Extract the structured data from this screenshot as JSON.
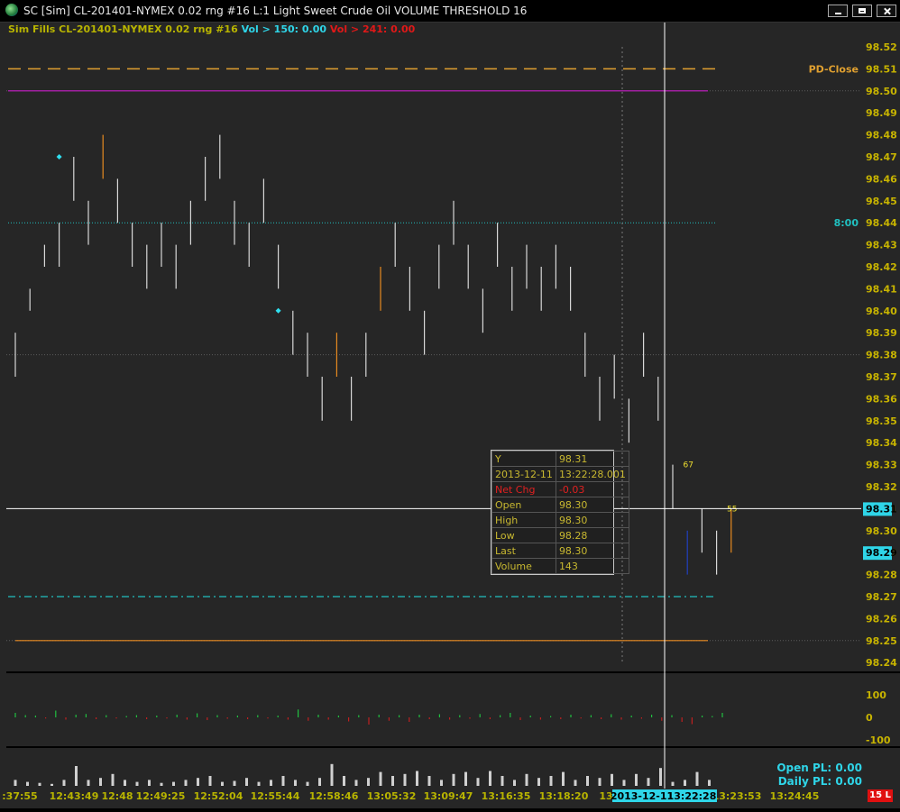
{
  "window": {
    "title": "SC [Sim]  CL-201401-NYMEX  0.02 rng  #16  L:1  Light Sweet Crude Oil  VOLUME THRESHOLD 16",
    "icons": [
      "globe-icon",
      "minimize-icon",
      "maximize-icon",
      "close-icon"
    ]
  },
  "legend": {
    "study": "Sim Fills  CL-201401-NYMEX  0.02 rng  #16",
    "vol_a": "Vol > 150: 0.00",
    "vol_b": "Vol > 241: 0.00"
  },
  "levels": {
    "pd_close_label": "PD-Close",
    "time_label": "8:00"
  },
  "colors": {
    "background": "#262626",
    "bar_white": "#d8d8d8",
    "bar_orange": "#e88a20",
    "bar_blue": "#2040c0",
    "pd_close": "#e0a030",
    "purple_line": "#a020a0",
    "cyan_line": "#20c0c0",
    "axis_text": "#c8b400",
    "cyan_badge": "#2fd5e8",
    "red_badge": "#e01010"
  },
  "data_window": {
    "rows": [
      {
        "label": "Y",
        "value": "98.31"
      },
      {
        "label": "2013-12-11",
        "value": "13:22:28.001"
      },
      {
        "label": "Net Chg",
        "value": "-0.03",
        "red": true
      },
      {
        "label": "Open",
        "value": "98.30"
      },
      {
        "label": "High",
        "value": "98.30"
      },
      {
        "label": "Low",
        "value": "98.28"
      },
      {
        "label": "Last",
        "value": "98.30"
      },
      {
        "label": "Volume",
        "value": "143"
      }
    ]
  },
  "footer": {
    "open_pl": "Open PL: 0.00",
    "daily_pl": "Daily PL: 0.00",
    "badge": "15 L",
    "cursor_date": "2013-12-11",
    "cursor_time": "13:22:28"
  },
  "chart_data": {
    "type": "bar",
    "subtype": "ohlc-range-bars",
    "y_ticks": [
      "98.52",
      "98.51",
      "98.50",
      "98.49",
      "98.48",
      "98.47",
      "98.46",
      "98.45",
      "98.44",
      "98.43",
      "98.42",
      "98.41",
      "98.40",
      "98.39",
      "98.38",
      "98.37",
      "98.36",
      "98.35",
      "98.34",
      "98.33",
      "98.32",
      "98.31",
      "98.30",
      "98.29",
      "98.28",
      "98.27",
      "98.26",
      "98.25",
      "98.24"
    ],
    "ylim": [
      98.24,
      98.52
    ],
    "x_ticks": [
      ":37:55",
      "12:43:49",
      "12:48",
      "12:49:25",
      "12:52:04",
      "12:55:44",
      "12:58:46",
      "13:05:32",
      "13:09:47",
      "13:16:35",
      "13:18:20",
      "13",
      "13:23:53",
      "13:24:45"
    ],
    "cursor_value": "98.31",
    "last_value": "98.29",
    "level_lines": {
      "pd_close": 98.51,
      "purple": 98.5,
      "cyan_dotted": 98.44,
      "cyan_dashdot": 98.27,
      "orange": 98.25
    },
    "bars": [
      {
        "high": 98.39,
        "low": 98.37,
        "color": "white"
      },
      {
        "high": 98.41,
        "low": 98.4,
        "color": "white"
      },
      {
        "high": 98.43,
        "low": 98.42,
        "color": "white"
      },
      {
        "high": 98.44,
        "low": 98.42,
        "color": "white"
      },
      {
        "high": 98.47,
        "low": 98.45,
        "color": "white"
      },
      {
        "high": 98.45,
        "low": 98.43,
        "color": "white"
      },
      {
        "high": 98.48,
        "low": 98.46,
        "color": "orange"
      },
      {
        "high": 98.46,
        "low": 98.44,
        "color": "white"
      },
      {
        "high": 98.44,
        "low": 98.42,
        "color": "white"
      },
      {
        "high": 98.43,
        "low": 98.41,
        "color": "white"
      },
      {
        "high": 98.44,
        "low": 98.42,
        "color": "white"
      },
      {
        "high": 98.43,
        "low": 98.41,
        "color": "white"
      },
      {
        "high": 98.45,
        "low": 98.43,
        "color": "white"
      },
      {
        "high": 98.47,
        "low": 98.45,
        "color": "white"
      },
      {
        "high": 98.48,
        "low": 98.46,
        "color": "white"
      },
      {
        "high": 98.45,
        "low": 98.43,
        "color": "white"
      },
      {
        "high": 98.44,
        "low": 98.42,
        "color": "white"
      },
      {
        "high": 98.46,
        "low": 98.44,
        "color": "white"
      },
      {
        "high": 98.43,
        "low": 98.41,
        "color": "white"
      },
      {
        "high": 98.4,
        "low": 98.38,
        "color": "white"
      },
      {
        "high": 98.39,
        "low": 98.37,
        "color": "white"
      },
      {
        "high": 98.37,
        "low": 98.35,
        "color": "white"
      },
      {
        "high": 98.39,
        "low": 98.37,
        "color": "orange"
      },
      {
        "high": 98.37,
        "low": 98.35,
        "color": "white"
      },
      {
        "high": 98.39,
        "low": 98.37,
        "color": "white"
      },
      {
        "high": 98.42,
        "low": 98.4,
        "color": "orange"
      },
      {
        "high": 98.44,
        "low": 98.42,
        "color": "white"
      },
      {
        "high": 98.42,
        "low": 98.4,
        "color": "white"
      },
      {
        "high": 98.4,
        "low": 98.38,
        "color": "white"
      },
      {
        "high": 98.43,
        "low": 98.41,
        "color": "white"
      },
      {
        "high": 98.45,
        "low": 98.43,
        "color": "white"
      },
      {
        "high": 98.43,
        "low": 98.41,
        "color": "white"
      },
      {
        "high": 98.41,
        "low": 98.39,
        "color": "white"
      },
      {
        "high": 98.44,
        "low": 98.42,
        "color": "white"
      },
      {
        "high": 98.42,
        "low": 98.4,
        "color": "white"
      },
      {
        "high": 98.43,
        "low": 98.41,
        "color": "white"
      },
      {
        "high": 98.42,
        "low": 98.4,
        "color": "white"
      },
      {
        "high": 98.43,
        "low": 98.41,
        "color": "white"
      },
      {
        "high": 98.42,
        "low": 98.4,
        "color": "white"
      },
      {
        "high": 98.39,
        "low": 98.37,
        "color": "white"
      },
      {
        "high": 98.37,
        "low": 98.35,
        "color": "white"
      },
      {
        "high": 98.38,
        "low": 98.36,
        "color": "white"
      },
      {
        "high": 98.36,
        "low": 98.34,
        "color": "white"
      },
      {
        "high": 98.39,
        "low": 98.37,
        "color": "white"
      },
      {
        "high": 98.37,
        "low": 98.35,
        "color": "white"
      },
      {
        "high": 98.33,
        "low": 98.31,
        "color": "white"
      },
      {
        "high": 98.3,
        "low": 98.28,
        "color": "blue"
      },
      {
        "high": 98.31,
        "low": 98.29,
        "color": "white"
      },
      {
        "high": 98.3,
        "low": 98.28,
        "color": "white"
      },
      {
        "high": 98.31,
        "low": 98.29,
        "color": "orange"
      }
    ],
    "markers": [
      {
        "bar": 3,
        "value": 98.47,
        "shape": "diamond"
      },
      {
        "bar": 18,
        "value": 98.4,
        "shape": "diamond"
      }
    ],
    "bar_labels": [
      {
        "bar": 46,
        "value": 98.33,
        "text": "67"
      },
      {
        "bar": 49,
        "value": 98.31,
        "text": "55"
      }
    ],
    "delta_ticks": [
      "100",
      "0",
      "-100"
    ],
    "delta": [
      20,
      10,
      8,
      -5,
      30,
      -10,
      12,
      15,
      -8,
      10,
      -5,
      6,
      10,
      -8,
      8,
      -5,
      12,
      -10,
      18,
      -12,
      10,
      -6,
      8,
      -8,
      10,
      -5,
      8,
      -10,
      35,
      -15,
      12,
      -10,
      8,
      -18,
      10,
      -32,
      12,
      -15,
      10,
      -20,
      12,
      -8,
      14,
      -10,
      10,
      -6,
      15,
      -8,
      10,
      20,
      -12,
      8,
      -10,
      6,
      -8,
      12,
      -5,
      10,
      -8,
      14,
      -10,
      8,
      -6,
      12,
      -15,
      10,
      -20,
      -30,
      8,
      6,
      20
    ],
    "volume": [
      6,
      4,
      3,
      2,
      6,
      20,
      6,
      8,
      12,
      6,
      4,
      6,
      3,
      4,
      6,
      8,
      10,
      4,
      5,
      8,
      4,
      6,
      10,
      6,
      4,
      8,
      22,
      10,
      6,
      8,
      14,
      10,
      12,
      15,
      10,
      6,
      12,
      14,
      8,
      15,
      10,
      6,
      12,
      8,
      10,
      14,
      6,
      10,
      8,
      12,
      6,
      12,
      8,
      18,
      4,
      6,
      14,
      6
    ]
  }
}
